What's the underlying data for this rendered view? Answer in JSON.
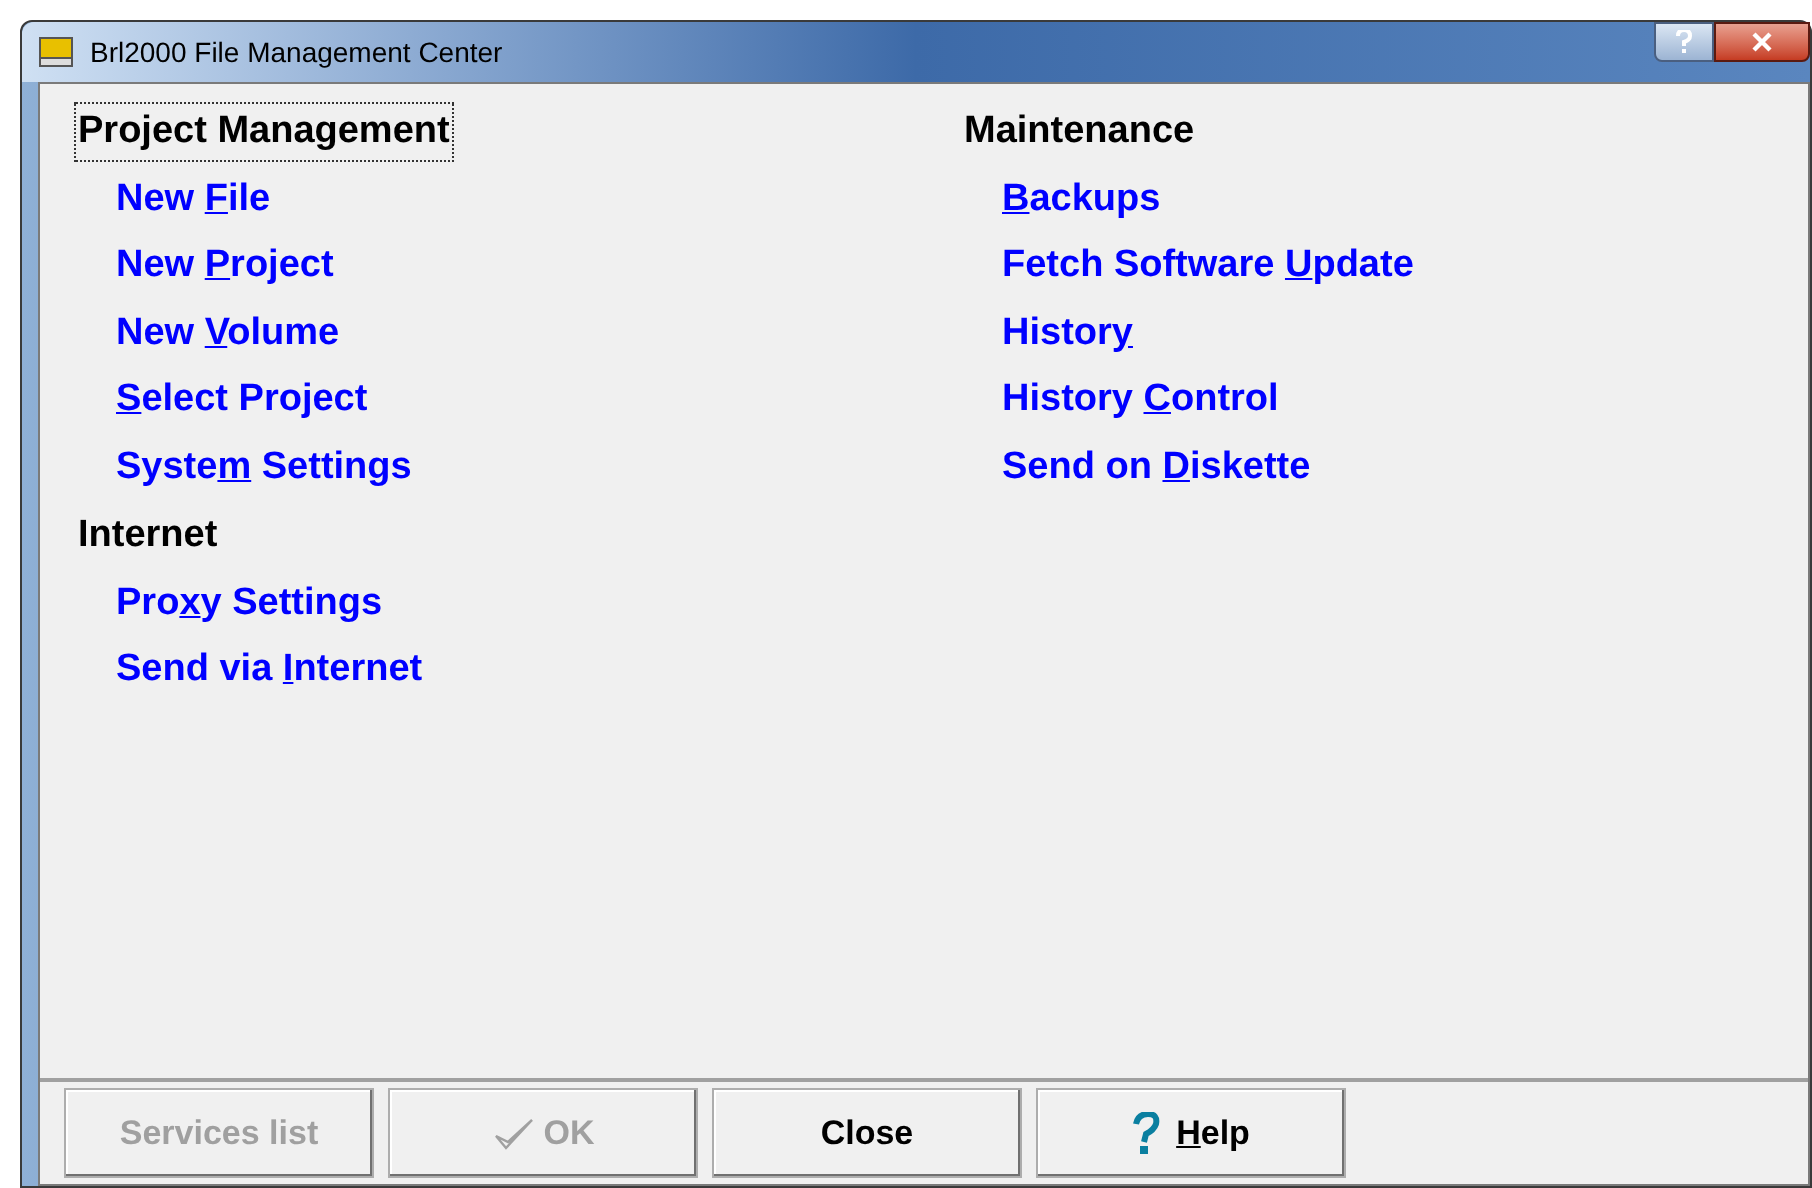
{
  "window": {
    "title": "Brl2000 File Management Center"
  },
  "columns": [
    {
      "groups": [
        {
          "heading": "Project Management",
          "focused": true,
          "links": [
            {
              "pre": "New ",
              "key": "F",
              "post": "ile"
            },
            {
              "pre": "New ",
              "key": "P",
              "post": "roject"
            },
            {
              "pre": "New ",
              "key": "V",
              "post": "olume"
            },
            {
              "key": "S",
              "post": "elect Project"
            },
            {
              "pre": "Syste",
              "key": "m",
              "post": " Settings"
            }
          ]
        },
        {
          "heading": "Internet",
          "focused": false,
          "links": [
            {
              "pre": "Pro",
              "key": "x",
              "post": "y Settings"
            },
            {
              "pre": "Send via ",
              "key": "I",
              "post": "nternet"
            }
          ]
        }
      ]
    },
    {
      "groups": [
        {
          "heading": "Maintenance",
          "focused": false,
          "links": [
            {
              "key": "B",
              "post": "ackups"
            },
            {
              "pre": "Fetch Software ",
              "key": "U",
              "post": "pdate"
            },
            {
              "pre": "Histor",
              "key": "y"
            },
            {
              "pre": "History ",
              "key": "C",
              "post": "ontrol"
            },
            {
              "pre": "Send on ",
              "key": "D",
              "post": "iskette"
            }
          ]
        }
      ]
    }
  ],
  "buttons": [
    {
      "kind": "plain",
      "pre": "Services list",
      "disabled": true
    },
    {
      "kind": "ok",
      "pre": "OK",
      "disabled": true
    },
    {
      "kind": "plain",
      "pre": "Close",
      "disabled": false
    },
    {
      "kind": "help",
      "key": "H",
      "post": "elp",
      "disabled": false
    }
  ]
}
